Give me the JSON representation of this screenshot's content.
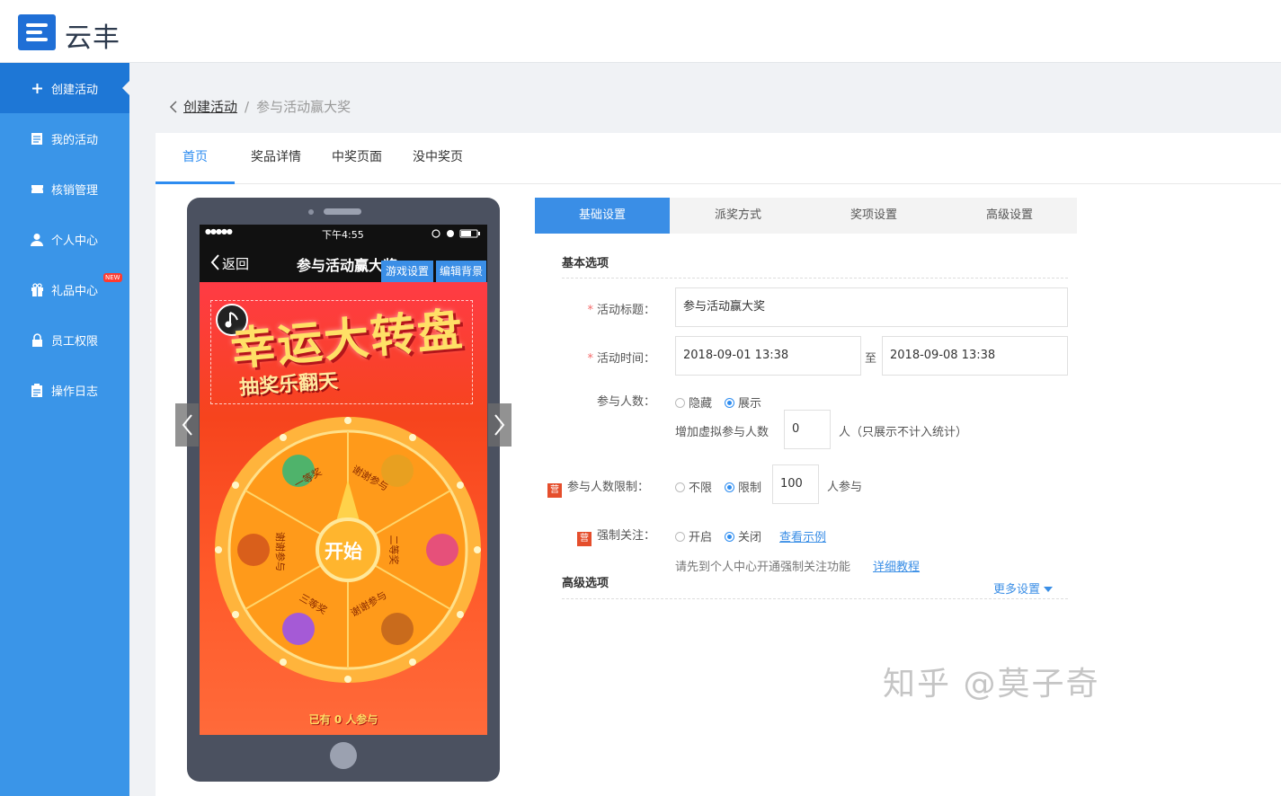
{
  "header": {
    "logo_text": "云丰"
  },
  "sidebar": {
    "items": [
      {
        "label": "创建活动",
        "icon": "plus-icon"
      },
      {
        "label": "我的活动",
        "icon": "document-icon"
      },
      {
        "label": "核销管理",
        "icon": "ticket-icon"
      },
      {
        "label": "个人中心",
        "icon": "user-icon"
      },
      {
        "label": "礼品中心",
        "icon": "gift-icon",
        "badge": "NEW"
      },
      {
        "label": "员工权限",
        "icon": "lock-icon"
      },
      {
        "label": "操作日志",
        "icon": "log-icon"
      }
    ]
  },
  "breadcrumb": {
    "back": "创建活动",
    "sep": "/",
    "current": "参与活动赢大奖"
  },
  "page_tabs": [
    "首页",
    "奖品详情",
    "中奖页面",
    "没中奖页"
  ],
  "phone": {
    "status": {
      "signal": "●●●●●",
      "time": "下午4:55"
    },
    "nav": {
      "back": "返回",
      "title": "参与活动赢大奖"
    },
    "buttons": {
      "game_settings": "游戏设置",
      "edit_bg": "编辑背景"
    },
    "banner": {
      "title": "幸运大转盘",
      "subtitle": "抽奖乐翻天"
    },
    "wheel": {
      "center": "开始",
      "segments": [
        "一等奖",
        "谢谢参与",
        "二等奖",
        "谢谢参与",
        "三等奖",
        "谢谢参与"
      ]
    },
    "participants": "已有 0 人参与"
  },
  "settings": {
    "tabs": [
      "基础设置",
      "派奖方式",
      "奖项设置",
      "高级设置"
    ],
    "basic_title": "基本选项",
    "title_label": "活动标题：",
    "title_value": "参与活动赢大奖",
    "time_label": "活动时间：",
    "start_time": "2018-09-01 13:38",
    "to": "至",
    "end_time": "2018-09-08 13:38",
    "count_label": "参与人数：",
    "count_options": [
      "隐藏",
      "展示"
    ],
    "virtual_label": "增加虚拟参与人数",
    "virtual_value": "0",
    "virtual_suffix": "人（只展示不计入统计）",
    "mark": "营",
    "limit_label": "参与人数限制：",
    "limit_options": [
      "不限",
      "限制"
    ],
    "limit_value": "100",
    "limit_suffix": "人参与",
    "follow_label": "强制关注：",
    "follow_options": [
      "开启",
      "关闭"
    ],
    "follow_example": "查看示例",
    "follow_hint": "请先到个人中心开通强制关注功能",
    "follow_tutorial": "详细教程",
    "advanced_title": "高级选项",
    "more": "更多设置"
  },
  "watermark": "知乎 @莫子奇",
  "colors": {
    "sidebar": "#3a95e8",
    "sidebar_active": "#1e77d6",
    "accent": "#3a8ee6",
    "wheel": "#ff9a1a"
  }
}
